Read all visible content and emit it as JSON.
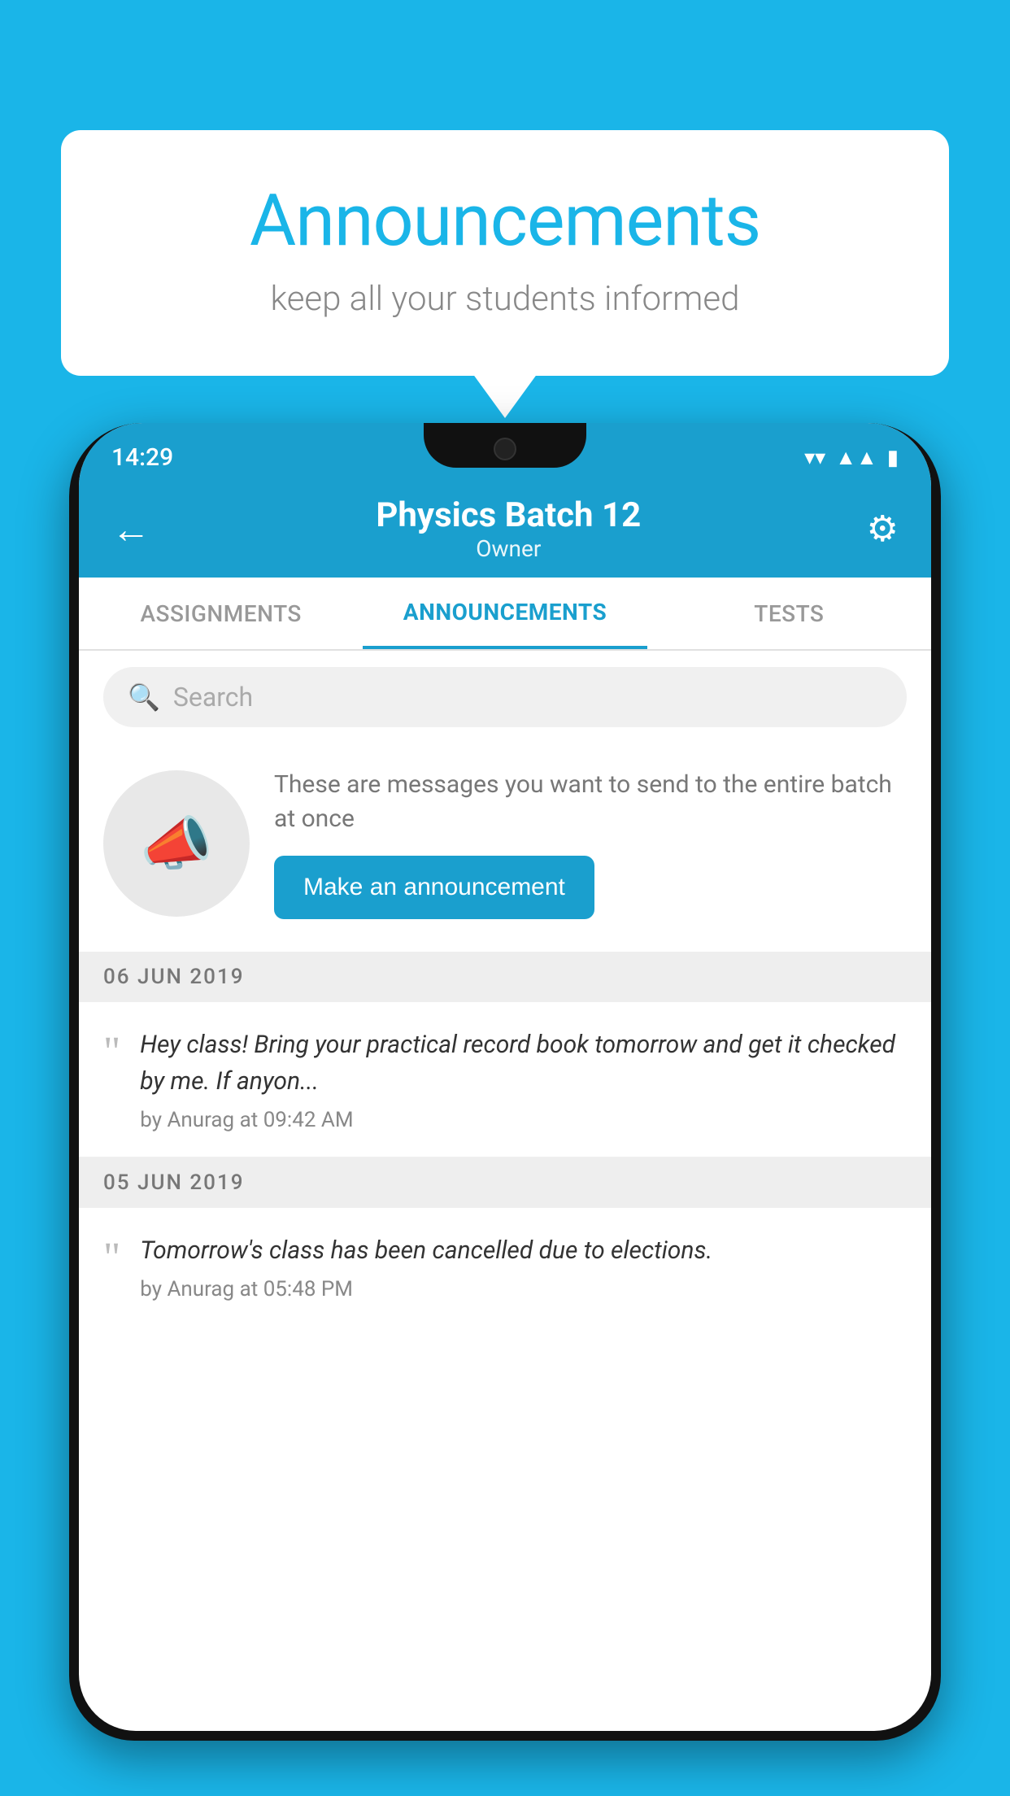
{
  "background_color": "#1ab5e8",
  "speech_bubble": {
    "title": "Announcements",
    "subtitle": "keep all your students informed"
  },
  "phone": {
    "status_bar": {
      "time": "14:29",
      "icons": [
        "wifi",
        "signal",
        "battery"
      ]
    },
    "header": {
      "title": "Physics Batch 12",
      "subtitle": "Owner",
      "back_label": "←",
      "settings_label": "⚙"
    },
    "tabs": [
      {
        "label": "ASSIGNMENTS",
        "active": false
      },
      {
        "label": "ANNOUNCEMENTS",
        "active": true
      },
      {
        "label": "TESTS",
        "active": false
      }
    ],
    "search": {
      "placeholder": "Search"
    },
    "promo": {
      "description": "These are messages you want to send to the entire batch at once",
      "button_label": "Make an announcement"
    },
    "announcements": [
      {
        "date": "06  JUN  2019",
        "text": "Hey class! Bring your practical record book tomorrow and get it checked by me. If anyon...",
        "meta": "by Anurag at 09:42 AM"
      },
      {
        "date": "05  JUN  2019",
        "text": "Tomorrow's class has been cancelled due to elections.",
        "meta": "by Anurag at 05:48 PM"
      }
    ]
  }
}
